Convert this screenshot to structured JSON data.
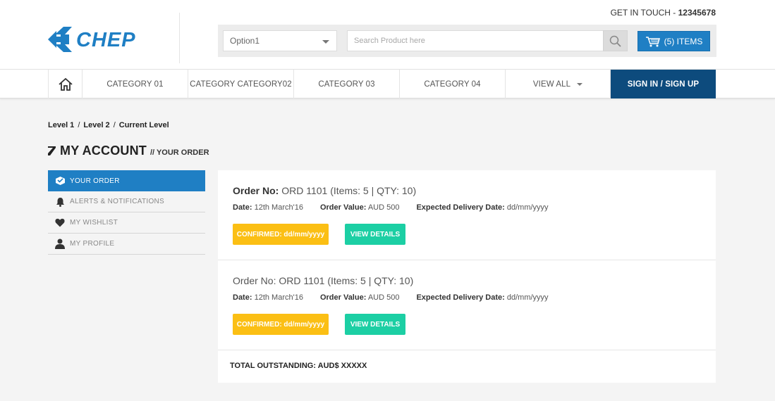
{
  "header": {
    "contact_label": "GET IN TOUCH - ",
    "contact_number": "12345678",
    "select_value": "Option1",
    "search_placeholder": "Search Product here",
    "cart_label": "(5) ITEMS"
  },
  "nav": {
    "items": [
      {
        "label": "CATEGORY 01"
      },
      {
        "label": "CATEGORY CATEGORY02"
      },
      {
        "label": "CATEGORY 03"
      },
      {
        "label": "CATEGORY 04"
      }
    ],
    "view_all": "VIEW ALL",
    "signin": "SIGN IN / SIGN UP"
  },
  "breadcrumb": [
    "Level 1",
    "Level 2",
    "Current Level"
  ],
  "page": {
    "title": "MY ACCOUNT",
    "subtitle": "// YOUR ORDER"
  },
  "sidebar": {
    "items": [
      {
        "label": "YOUR ORDER",
        "icon": "order-icon"
      },
      {
        "label": "ALERTS & NOTIFICATIONS",
        "icon": "bell-icon"
      },
      {
        "label": "MY WISHLIST",
        "icon": "heart-icon"
      },
      {
        "label": "MY PROFILE",
        "icon": "user-icon"
      }
    ]
  },
  "orders": [
    {
      "order_no_label": "Order No:",
      "order_no": "ORD 1101 (Items: 5 | QTY: 10)",
      "date_label": "Date:",
      "date": "12th March'16",
      "value_label": "Order Value:",
      "value": "AUD 500",
      "delivery_label": "Expected Delivery Date:",
      "delivery": "dd/mm/yyyy",
      "status": "CONFIRMED: dd/mm/yyyy",
      "action": "VIEW DETAILS"
    },
    {
      "order_no_label": "Order No:",
      "order_no": "ORD 1101 (Items: 5 | QTY: 10)",
      "date_label": "Date:",
      "date": "12th March'16",
      "value_label": "Order Value:",
      "value": "AUD 500",
      "delivery_label": "Expected Delivery Date:",
      "delivery": "dd/mm/yyyy",
      "status": "CONFIRMED: dd/mm/yyyy",
      "action": "VIEW DETAILS"
    }
  ],
  "total_outstanding": "TOTAL OUTSTANDING: AUD$ XXXXX",
  "colors": {
    "brand_blue": "#1f7fc4",
    "nav_dark": "#0d4b7d",
    "confirm_yellow": "#fbbf14",
    "view_teal": "#1ccfa4"
  },
  "brand": {
    "logo_text": "CHEP"
  }
}
